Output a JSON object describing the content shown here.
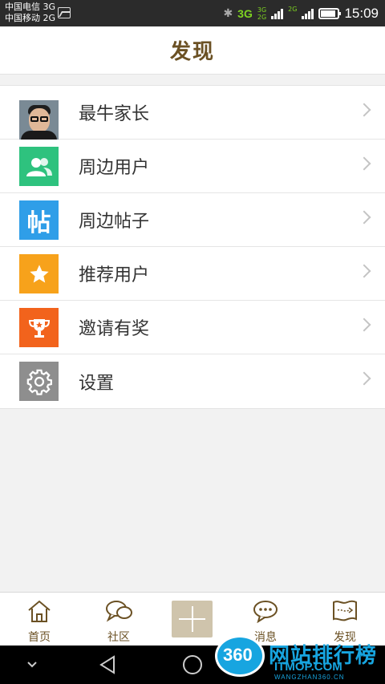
{
  "status_bar": {
    "carrier_1": "中国电信 3G",
    "carrier_2": "中国移动 2G",
    "network_main": "3G",
    "network_small_top": "3G",
    "network_small_bottom": "2G",
    "network_right": "2G",
    "time": "15:09",
    "icons": [
      "gallery-icon",
      "bluetooth-icon",
      "signal-icon",
      "battery-icon"
    ]
  },
  "header": {
    "title": "发现"
  },
  "menu": {
    "items": [
      {
        "label": "最牛家长",
        "icon": "avatar",
        "color": "#7a8a95"
      },
      {
        "label": "周边用户",
        "icon": "users-icon",
        "color": "#2ec27e"
      },
      {
        "label": "周边帖子",
        "icon": "post-icon",
        "color": "#2f9ee8",
        "icon_text": "帖"
      },
      {
        "label": "推荐用户",
        "icon": "star-icon",
        "color": "#f7a21b"
      },
      {
        "label": "邀请有奖",
        "icon": "trophy-icon",
        "color": "#f2631c"
      },
      {
        "label": "设置",
        "icon": "gear-icon",
        "color": "#8e8e8e"
      }
    ]
  },
  "tabbar": {
    "tabs": [
      {
        "label": "首页",
        "icon": "home-icon"
      },
      {
        "label": "社区",
        "icon": "chat-icon"
      },
      {
        "label": "",
        "icon": "plus-icon"
      },
      {
        "label": "消息",
        "icon": "message-icon"
      },
      {
        "label": "发现",
        "icon": "map-icon"
      }
    ],
    "text_color": "#6b5124"
  },
  "watermark": {
    "badge": "360",
    "title": "网站排行榜",
    "domain": "ITMOP.COM",
    "domain_small": "WANGZHAN360.CN"
  }
}
